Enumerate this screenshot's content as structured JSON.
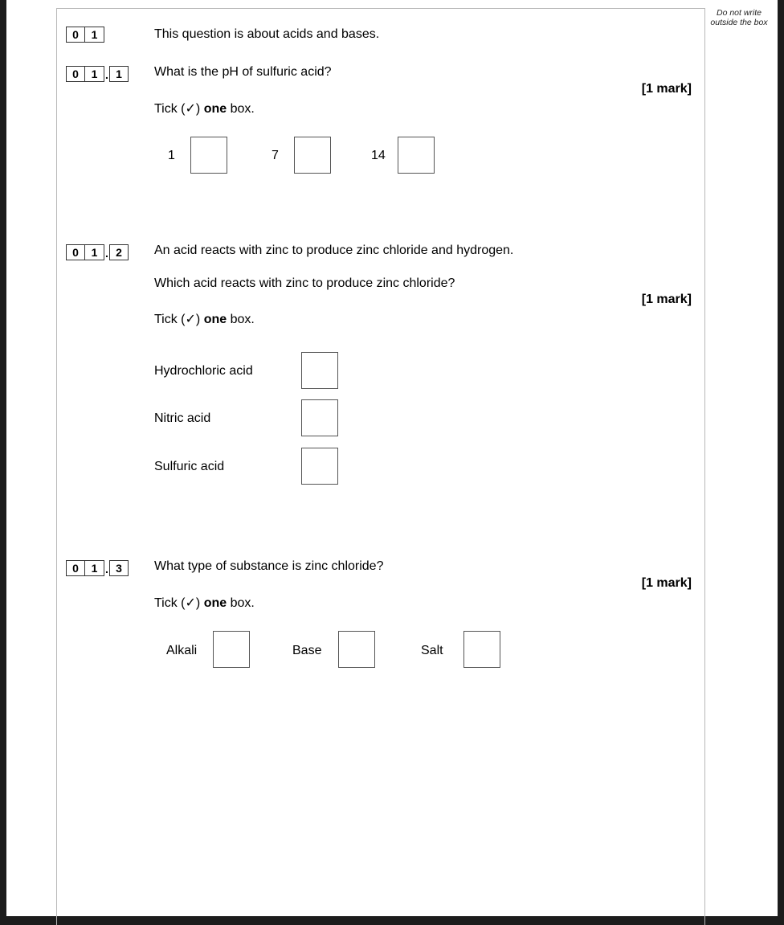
{
  "margin_note": "Do not write outside the box",
  "question": {
    "number": [
      "0",
      "1"
    ],
    "intro": "This question is about acids and bases."
  },
  "parts": [
    {
      "number": [
        "0",
        "1",
        "1"
      ],
      "lines": [
        "What is the pH of sulfuric acid?"
      ],
      "marks": "[1 mark]",
      "instruction": {
        "pre": "Tick (✓) ",
        "bold": "one",
        "post": " box."
      },
      "options": [
        "1",
        "7",
        "14"
      ]
    },
    {
      "number": [
        "0",
        "1",
        "2"
      ],
      "lines": [
        "An acid reacts with zinc to produce zinc chloride and hydrogen.",
        "Which acid reacts with zinc to produce zinc chloride?"
      ],
      "marks": "[1 mark]",
      "instruction": {
        "pre": "Tick (✓) ",
        "bold": "one",
        "post": " box."
      },
      "options": [
        "Hydrochloric acid",
        "Nitric acid",
        "Sulfuric acid"
      ]
    },
    {
      "number": [
        "0",
        "1",
        "3"
      ],
      "lines": [
        "What type of substance is zinc chloride?"
      ],
      "marks": "[1 mark]",
      "instruction": {
        "pre": "Tick (✓) ",
        "bold": "one",
        "post": " box."
      },
      "options": [
        "Alkali",
        "Base",
        "Salt"
      ]
    }
  ]
}
